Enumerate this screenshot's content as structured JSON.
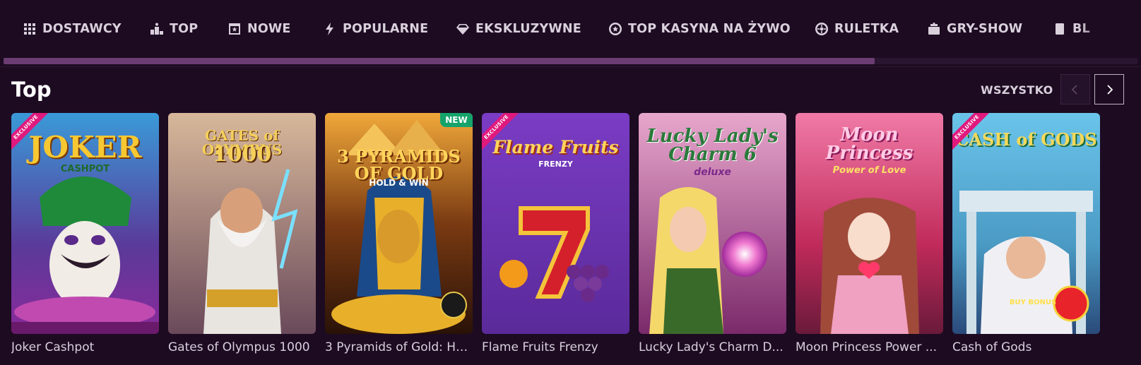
{
  "nav": {
    "items": [
      {
        "label": "DOSTAWCY",
        "icon": "grid-icon"
      },
      {
        "label": "TOP",
        "icon": "podium-icon"
      },
      {
        "label": "NOWE",
        "icon": "new-badge-icon"
      },
      {
        "label": "POPULARNE",
        "icon": "lightning-icon"
      },
      {
        "label": "EKSKLUZYWNE",
        "icon": "diamond-icon"
      },
      {
        "label": "TOP KASYNA NA ŻYWO",
        "icon": "chip-icon"
      },
      {
        "label": "RULETKA",
        "icon": "roulette-icon"
      },
      {
        "label": "GRY-SHOW",
        "icon": "game-show-icon"
      },
      {
        "label": "BL",
        "icon": "blackjack-icon"
      }
    ]
  },
  "section": {
    "title": "Top",
    "see_all": "WSZYSTKO"
  },
  "games": [
    {
      "name": "Joker Cashpot",
      "ribbon": "EXCLUSIVE",
      "logo": "JOKER",
      "logo2": "CASHPOT",
      "colors": [
        "#3a8fd4",
        "#6a2a8a"
      ]
    },
    {
      "name": "Gates of Olympus 1000",
      "logo": "GATES of OLYMPUS",
      "logo2": "1000",
      "colors": [
        "#b79a7a",
        "#5a4a6a"
      ]
    },
    {
      "name": "3 Pyramids of Gold: Ho...",
      "badge": "NEW",
      "logo": "3 PYRAMIDS OF GOLD",
      "logo2": "HOLD & WIN",
      "colors": [
        "#d98a2a",
        "#3a1a12"
      ]
    },
    {
      "name": "Flame Fruits Frenzy",
      "ribbon": "EXCLUSIVE",
      "logo": "Flame Fruits",
      "logo2": "FRENZY",
      "colors": [
        "#7a3cc0",
        "#5a2a9a"
      ]
    },
    {
      "name": "Lucky Lady's Charm D...",
      "logo": "Lucky Lady's Charm 6",
      "logo2": "deluxe",
      "colors": [
        "#d89ac0",
        "#8a3a7a"
      ]
    },
    {
      "name": "Moon Princess Power ...",
      "logo": "Moon Princess",
      "logo2": "Power of Love",
      "colors": [
        "#e05a8a",
        "#7a1a3a"
      ]
    },
    {
      "name": "Cash of Gods",
      "ribbon": "EXCLUSIVE",
      "logo": "CASH of GODS",
      "logo2": "BUY BONUS",
      "colors": [
        "#5ab8e0",
        "#2a5a8a"
      ]
    }
  ]
}
